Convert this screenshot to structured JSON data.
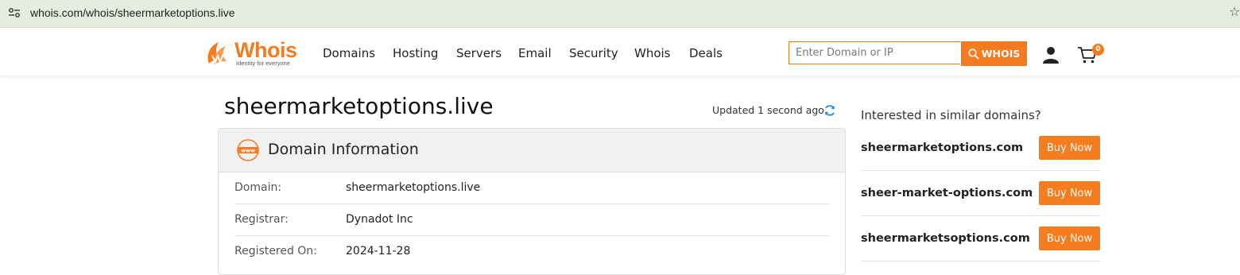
{
  "browser": {
    "url": "whois.com/whois/sheermarketoptions.live"
  },
  "header": {
    "logo_text": "Whois",
    "logo_tagline": "Identity for everyone",
    "nav": [
      "Domains",
      "Hosting",
      "Servers",
      "Email",
      "Security",
      "Whois",
      "Deals"
    ],
    "search_placeholder": "Enter Domain or IP",
    "search_button": "WHOIS",
    "cart_count": "0"
  },
  "main": {
    "title": "sheermarketoptions.live",
    "updated": "Updated 1 second ago",
    "panel": {
      "title": "Domain Information",
      "icon_text": "www",
      "rows": [
        {
          "label": "Domain:",
          "value": "sheermarketoptions.live"
        },
        {
          "label": "Registrar:",
          "value": "Dynadot Inc"
        },
        {
          "label": "Registered On:",
          "value": "2024-11-28"
        }
      ]
    }
  },
  "sidebar": {
    "title": "Interested in similar domains?",
    "suggestions": [
      {
        "domain": "sheermarketoptions.com",
        "button": "Buy Now"
      },
      {
        "domain": "sheer-market-options.com",
        "button": "Buy Now"
      },
      {
        "domain": "sheermarketsoptions.com",
        "button": "Buy Now"
      }
    ]
  },
  "colors": {
    "brand_orange": "#f47b20",
    "address_bar_bg": "#e6ede0",
    "panel_header_bg": "#f1f1f1"
  }
}
